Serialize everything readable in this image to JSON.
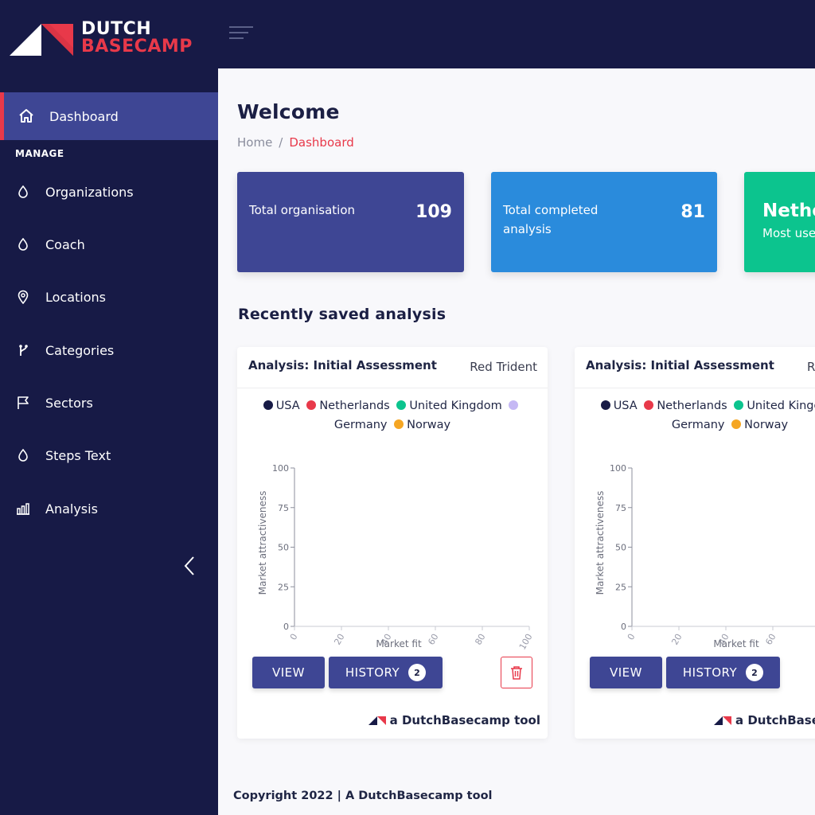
{
  "brand": {
    "line1": "DUTCH",
    "line2": "BASECAMP",
    "accent": "#e8394a",
    "navy": "#171a46"
  },
  "sidebar": {
    "active": {
      "label": "Dashboard",
      "icon": "home-icon"
    },
    "section_label": "MANAGE",
    "items": [
      {
        "label": "Organizations",
        "icon": "drop-icon"
      },
      {
        "label": "Coach",
        "icon": "drop-icon"
      },
      {
        "label": "Locations",
        "icon": "map-pin-icon"
      },
      {
        "label": "Categories",
        "icon": "branch-icon"
      },
      {
        "label": "Sectors",
        "icon": "flag-icon"
      },
      {
        "label": "Steps Text",
        "icon": "drop-icon"
      },
      {
        "label": "Analysis",
        "icon": "bar-chart-icon"
      }
    ]
  },
  "page": {
    "title": "Welcome",
    "breadcrumb": {
      "home": "Home",
      "separator": "/",
      "current": "Dashboard"
    }
  },
  "stats": [
    {
      "label": "Total organisation",
      "value": "109",
      "color": "#3e4694"
    },
    {
      "label": "Total completed analysis",
      "value": "81",
      "color": "#2a8bdc"
    },
    {
      "label": "Nethe",
      "sub": "Most use",
      "color": "#0cc48e"
    }
  ],
  "recent": {
    "title": "Recently saved analysis",
    "cards": [
      {
        "title": "Analysis: Initial Assessment",
        "org": "Red Trident",
        "view_label": "VIEW",
        "history_label": "HISTORY",
        "history_count": "2",
        "footer": "a DutchBasecamp tool"
      },
      {
        "title": "Analysis: Initial Assessment",
        "org": "R",
        "view_label": "VIEW",
        "history_label": "HISTORY",
        "history_count": "2",
        "footer": "a DutchBasecamp tool"
      }
    ]
  },
  "legend": [
    {
      "name": "USA",
      "color": "#171a46"
    },
    {
      "name": "Netherlands",
      "color": "#e8394a"
    },
    {
      "name": "United Kingdom",
      "color": "#0cc48e"
    },
    {
      "name": "Germany",
      "color": "#c5b8f4"
    },
    {
      "name": "Norway",
      "color": "#f5a623"
    }
  ],
  "chart_data": [
    {
      "type": "scatter",
      "title": "",
      "xlabel": "Market fit",
      "ylabel": "Market attractiveness",
      "xlim": [
        0,
        100
      ],
      "ylim": [
        0,
        100
      ],
      "x_ticks": [
        "0",
        "20",
        "40",
        "60",
        "80",
        "100"
      ],
      "y_ticks": [
        "0",
        "25",
        "50",
        "75",
        "100"
      ],
      "series": []
    },
    {
      "type": "scatter",
      "title": "",
      "xlabel": "Market fit",
      "ylabel": "Market attractiveness",
      "xlim": [
        0,
        100
      ],
      "ylim": [
        0,
        100
      ],
      "x_ticks": [
        "0",
        "20",
        "40",
        "60"
      ],
      "y_ticks": [
        "0",
        "25",
        "50",
        "75",
        "100"
      ],
      "series": []
    }
  ],
  "footer": {
    "copyright": "Copyright 2022  |  A DutchBasecamp tool"
  }
}
